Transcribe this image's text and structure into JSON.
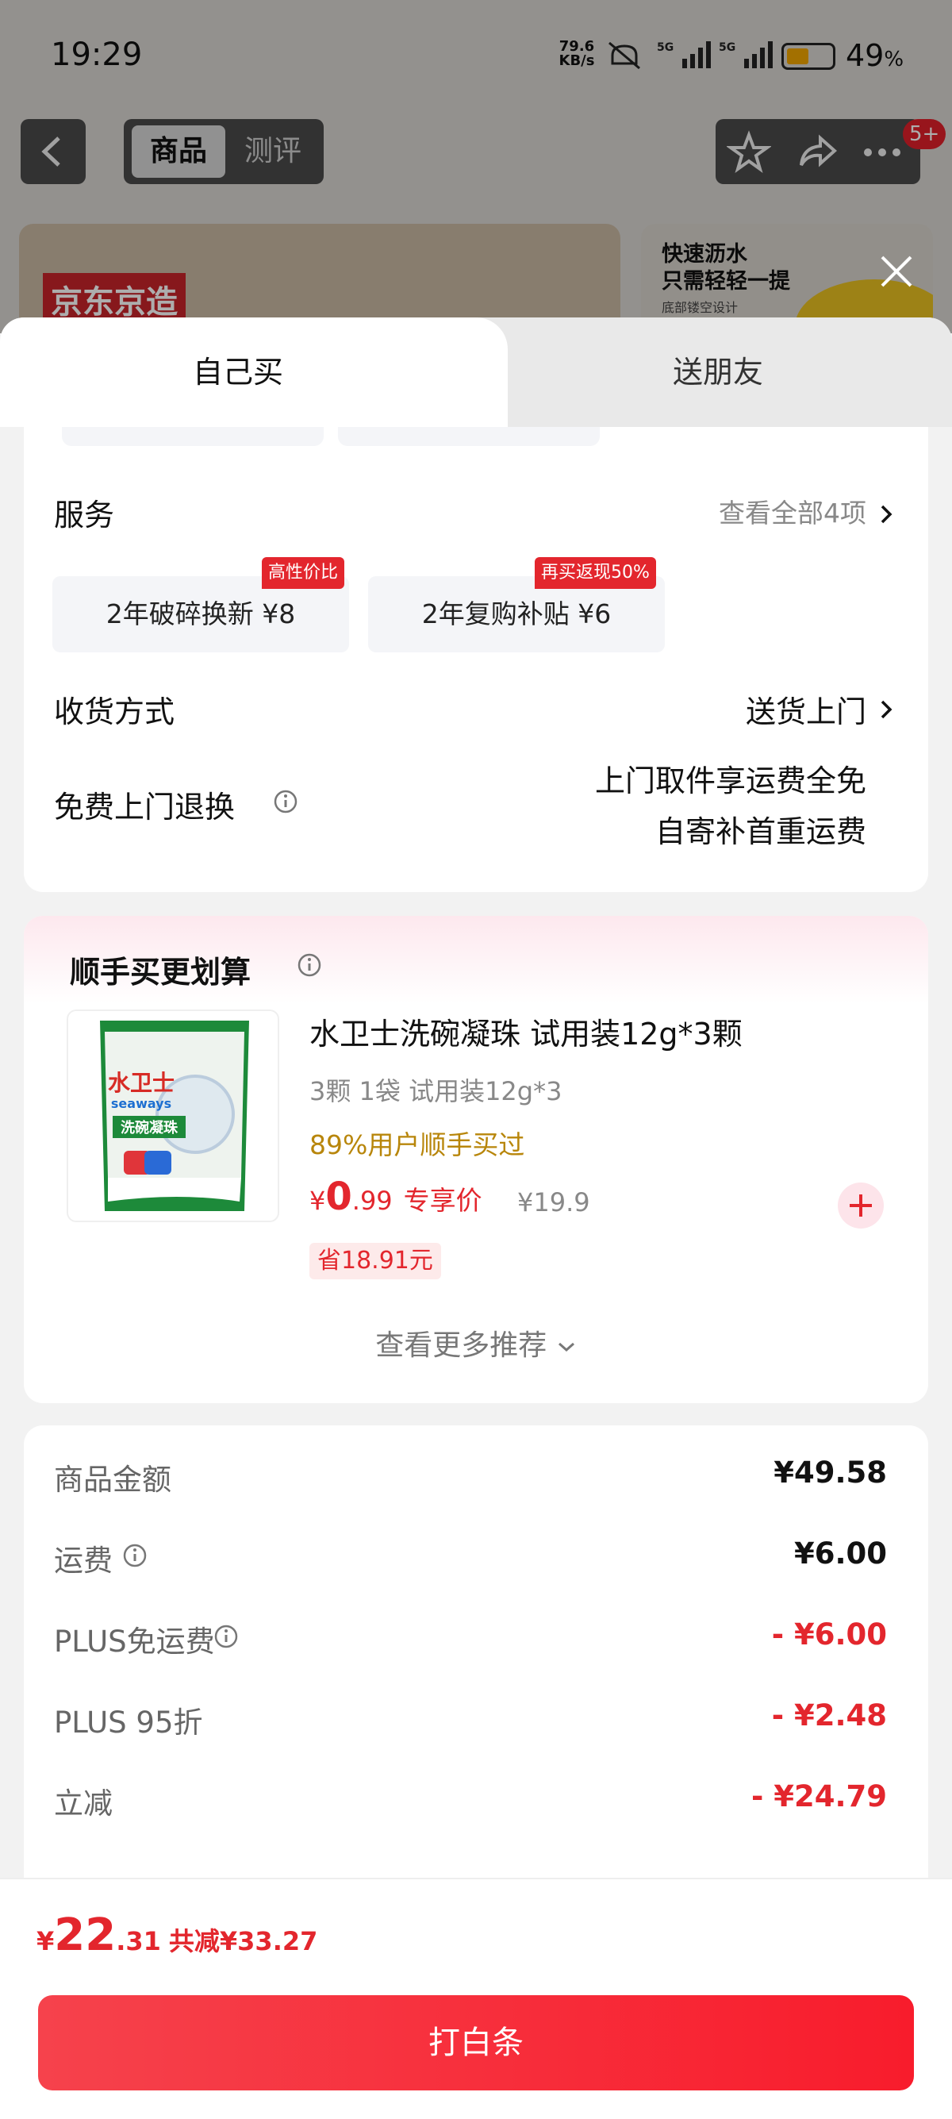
{
  "status_bar": {
    "time": "19:29",
    "net_speed": "79.6",
    "net_unit": "KB/s",
    "sig1": "5G",
    "sig2": "5G",
    "battery_pct": "49",
    "pct_sign": "%",
    "battery_level": 0.49
  },
  "nav": {
    "tab_product": "商品",
    "tab_review": "测评",
    "badge": "5+"
  },
  "background": {
    "brand_text": "京东京造",
    "promo_line1": "快速沥水",
    "promo_line2": "只需轻轻一提",
    "promo_small": "底部镂空设计"
  },
  "sheet_tabs": {
    "self": "自己买",
    "friend": "送朋友"
  },
  "services": {
    "title": "服务",
    "view_all": "查看全部4项",
    "items": [
      {
        "label": "2年破碎换新  ¥8",
        "tag": "高性价比"
      },
      {
        "label": "2年复购补贴  ¥6",
        "tag": "再买返现50%"
      }
    ]
  },
  "delivery": {
    "label": "收货方式",
    "value": "送货上门"
  },
  "returns": {
    "label": "免费上门退换",
    "line1": "上门取件享运费全免",
    "line2": "自寄补首重运费"
  },
  "recommend": {
    "title": "顺手买更划算",
    "product": {
      "title": "水卫士洗碗凝珠 试用装12g*3颗",
      "spec": "3颗 1袋 试用装12g*3",
      "pct": "89%用户顺手买过",
      "price_yen": "¥",
      "price_int": "0",
      "price_dec": ".99",
      "price_label": "专享价",
      "orig_price": "¥19.9",
      "save": "省18.91元",
      "pkg_brand": "水卫士",
      "pkg_brand_en": "seaways",
      "pkg_name": "洗碗凝珠"
    },
    "more": "查看更多推荐"
  },
  "amounts": [
    {
      "label": "商品金额",
      "value": "¥49.58",
      "info": false,
      "red": false
    },
    {
      "label": "运费",
      "value": "¥6.00",
      "info": true,
      "red": false
    },
    {
      "label": "PLUS免运费",
      "value": "- ¥6.00",
      "info": true,
      "red": true
    },
    {
      "label": "PLUS 95折",
      "value": "- ¥2.48",
      "info": false,
      "red": true
    },
    {
      "label": "立减",
      "value": "- ¥24.79",
      "info": false,
      "red": true
    }
  ],
  "footer": {
    "yen": "¥",
    "total_int": "22",
    "total_dec": ".31",
    "total_reduce": "共减¥33.27",
    "pay_button": "打白条"
  },
  "colors": {
    "accent_red": "#e3262d",
    "pay_gradient_start": "#f6424c",
    "pay_gradient_end": "#f81c2c",
    "percent_gold": "#b8860b"
  }
}
